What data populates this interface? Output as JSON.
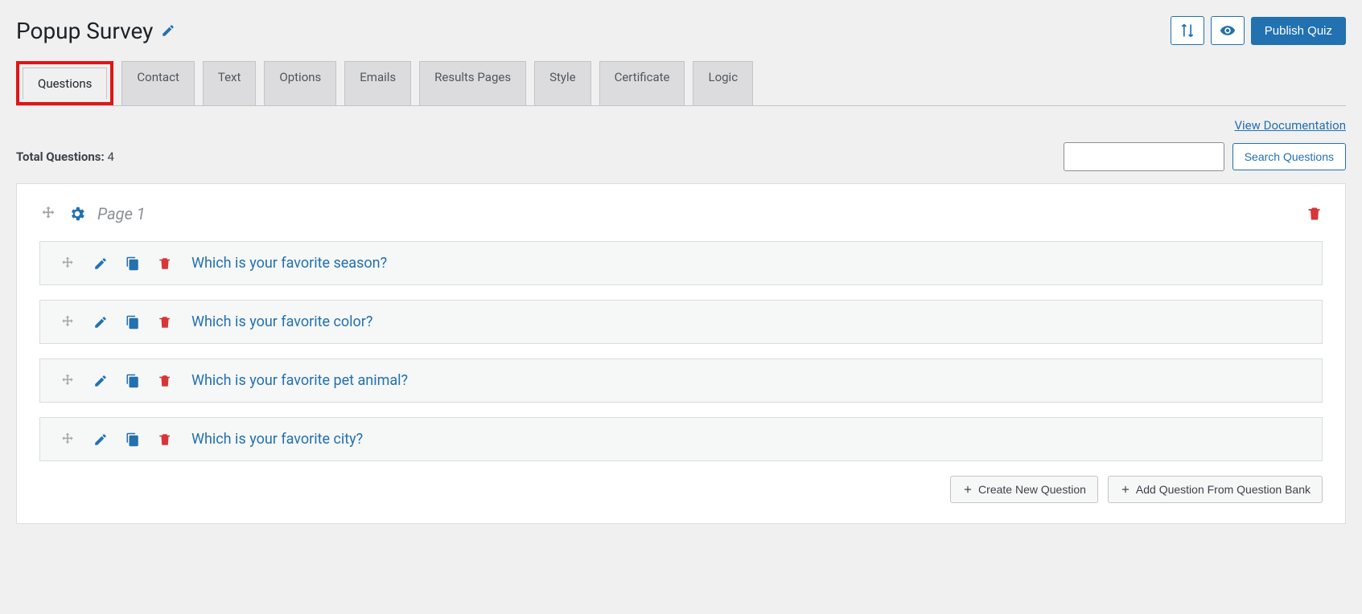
{
  "header": {
    "title": "Popup Survey",
    "publish_label": "Publish Quiz"
  },
  "tabs": [
    "Questions",
    "Contact",
    "Text",
    "Options",
    "Emails",
    "Results Pages",
    "Style",
    "Certificate",
    "Logic"
  ],
  "doc_link": "View Documentation",
  "total_questions_label": "Total Questions:",
  "total_questions_count": "4",
  "search_button": "Search Questions",
  "page_label": "Page 1",
  "questions": [
    "Which is your favorite season?",
    "Which is your favorite color?",
    "Which is your favorite pet animal?",
    "Which is your favorite city?"
  ],
  "create_new_label": "Create New Question",
  "add_from_bank_label": "Add Question From Question Bank"
}
